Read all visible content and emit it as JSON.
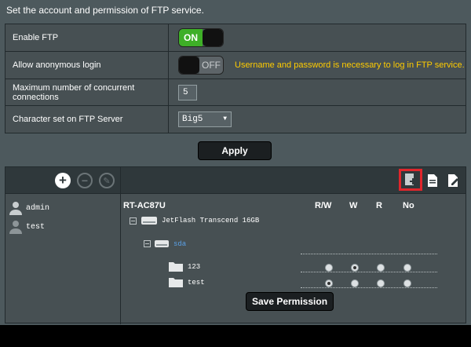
{
  "intro": "Set the account and permission of FTP service.",
  "settings": {
    "enable_ftp": {
      "label": "Enable FTP",
      "state": "ON"
    },
    "anonymous": {
      "label": "Allow anonymous login",
      "state": "OFF",
      "hint": "Username and password is necessary to log in FTP service."
    },
    "max_conn": {
      "label": "Maximum number of concurrent connections",
      "value": "5"
    },
    "charset": {
      "label": "Character set on FTP Server",
      "value": "Big5"
    }
  },
  "apply_label": "Apply",
  "users": [
    {
      "name": "admin"
    },
    {
      "name": "test"
    }
  ],
  "tree": {
    "router": "RT-AC87U",
    "columns": [
      "R/W",
      "W",
      "R",
      "No"
    ],
    "drive": "JetFlash Transcend 16GB",
    "partition": "sda",
    "folders": [
      {
        "name": "123",
        "selected": "W"
      },
      {
        "name": "test",
        "selected": "R/W"
      }
    ]
  },
  "save_label": "Save Permission",
  "colors": {
    "accent_on": "#3eaf27",
    "hint": "#ffcc00",
    "highlight_border": "#e0262c",
    "partition_link": "#5aa0e6"
  }
}
